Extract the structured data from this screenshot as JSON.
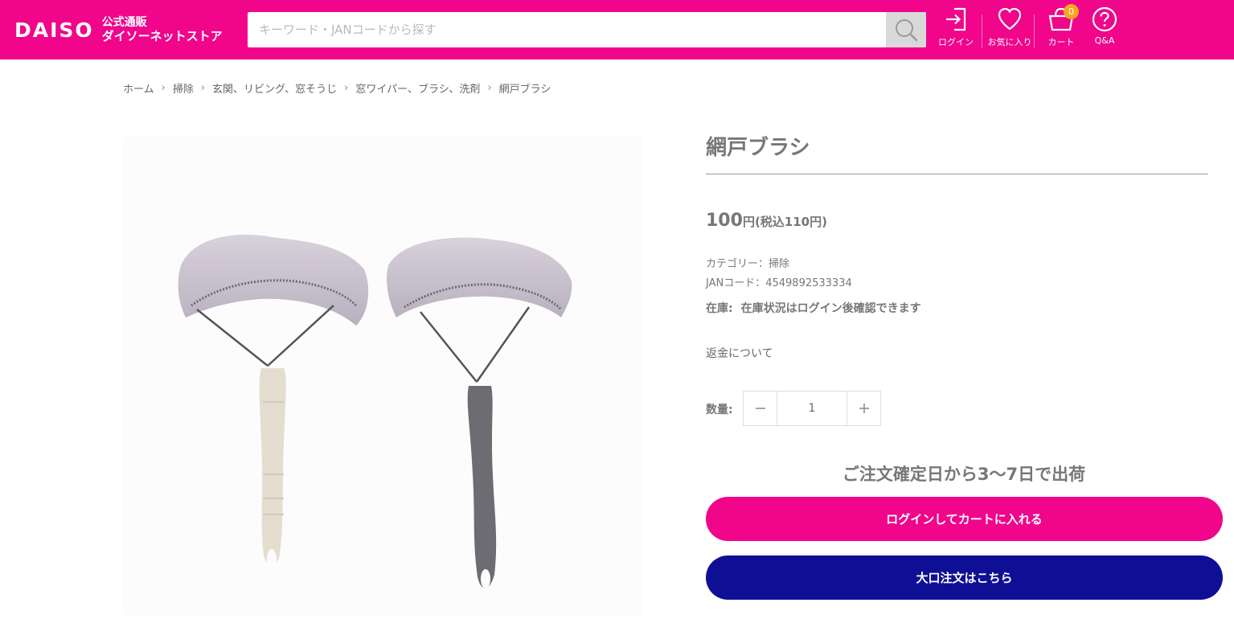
{
  "header": {
    "logo_text": "DAISO",
    "logo_sub_line1": "公式通販",
    "logo_sub_line2": "ダイソーネットストア",
    "search_placeholder": "キーワード・JANコードから探す",
    "login_label": "ログイン",
    "favorites_label": "お気に入り",
    "cart_label": "カート",
    "cart_count": "0",
    "qa_label": "Q&A",
    "brand_color": "#f0058b"
  },
  "breadcrumb": [
    "ホーム",
    "掃除",
    "玄関、リビング、窓そうじ",
    "窓ワイパー、ブラシ、洗剤",
    "網戸ブラシ"
  ],
  "breadcrumb_separator": "›",
  "product": {
    "title": "網戸ブラシ",
    "price_number": "100",
    "price_unit": "円",
    "price_tax": "(税込110円)",
    "category_line": "カテゴリー：掃除",
    "jan_line": "JANコード：4549892533334",
    "stock_label": "在庫:",
    "stock_value": "在庫状況はログイン後確認できます",
    "refund_link": "返金について",
    "quantity_label": "数量:",
    "quantity_value": "1",
    "shipping_note": "ご注文確定日から3〜7日で出荷",
    "add_to_cart_label": "ログインしてカートに入れる",
    "bulk_order_label": "大口注文はこちら",
    "bulk_color": "#0f0f96"
  }
}
